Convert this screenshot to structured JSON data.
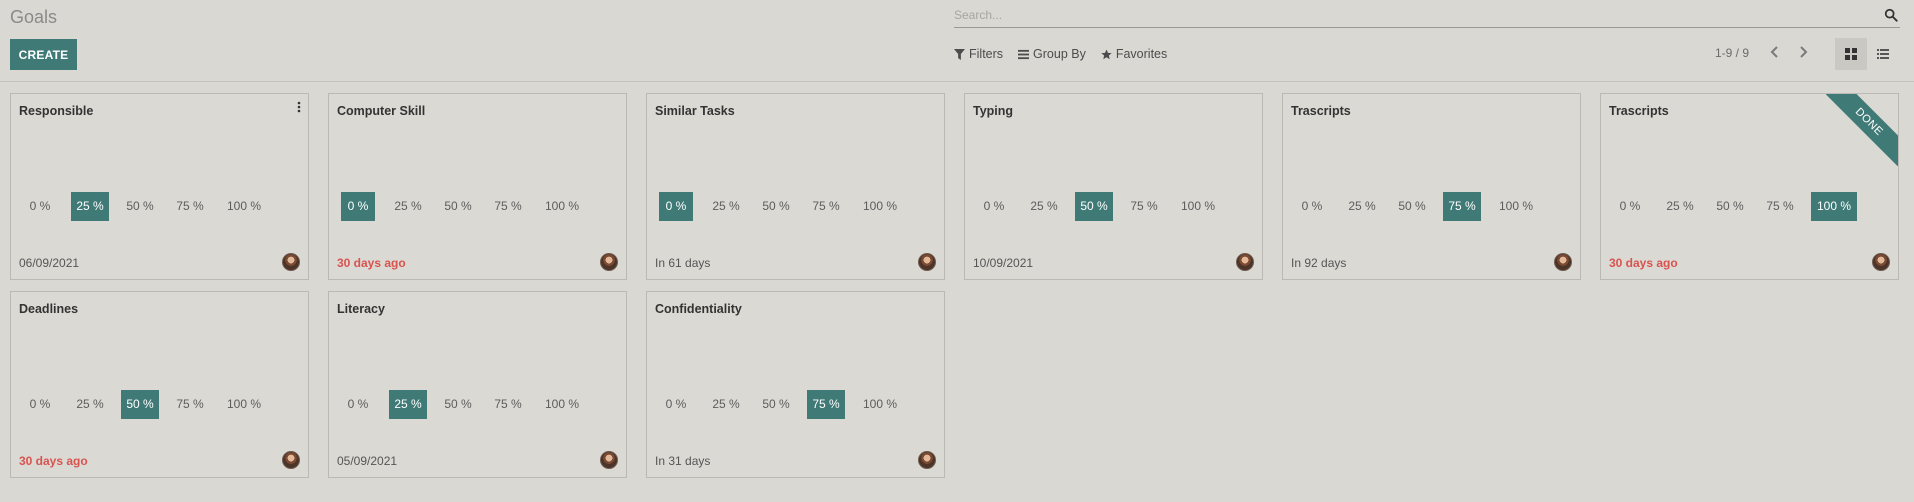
{
  "header": {
    "title": "Goals",
    "create_label": "CREATE",
    "search_placeholder": "Search...",
    "filters_label": "Filters",
    "groupby_label": "Group By",
    "favorites_label": "Favorites",
    "pager_text": "1-9 / 9"
  },
  "icons": {
    "search": "search-icon",
    "filter": "filter-icon",
    "groupby": "list-bars-icon",
    "favorites": "star-icon",
    "prev": "chevron-left-icon",
    "next": "chevron-right-icon",
    "kanban": "kanban-view-icon",
    "list": "list-view-icon",
    "menu": "vertical-dots-icon"
  },
  "colors": {
    "accent": "#3f7a77",
    "overdue": "#d9534f",
    "background": "#d9d8d3"
  },
  "levels": [
    "0 %",
    "25 %",
    "50 %",
    "75 %",
    "100 %"
  ],
  "cards": [
    {
      "title": "Responsible",
      "active_level": 1,
      "date": "06/09/2021",
      "overdue": false,
      "ribbon": "",
      "menu": true
    },
    {
      "title": "Computer Skill",
      "active_level": 0,
      "date": "30 days ago",
      "overdue": true,
      "ribbon": "",
      "menu": false
    },
    {
      "title": "Similar Tasks",
      "active_level": 0,
      "date": "In 61 days",
      "overdue": false,
      "ribbon": "",
      "menu": false
    },
    {
      "title": "Typing",
      "active_level": 2,
      "date": "10/09/2021",
      "overdue": false,
      "ribbon": "",
      "menu": false
    },
    {
      "title": "Trascripts",
      "active_level": 3,
      "date": "In 92 days",
      "overdue": false,
      "ribbon": "",
      "menu": false
    },
    {
      "title": "Trascripts",
      "active_level": 4,
      "date": "30 days ago",
      "overdue": true,
      "ribbon": "DONE",
      "menu": false
    },
    {
      "title": "Deadlines",
      "active_level": 2,
      "date": "30 days ago",
      "overdue": true,
      "ribbon": "",
      "menu": false
    },
    {
      "title": "Literacy",
      "active_level": 1,
      "date": "05/09/2021",
      "overdue": false,
      "ribbon": "",
      "menu": false
    },
    {
      "title": "Confidentiality",
      "active_level": 3,
      "date": "In 31 days",
      "overdue": false,
      "ribbon": "",
      "menu": false
    }
  ]
}
